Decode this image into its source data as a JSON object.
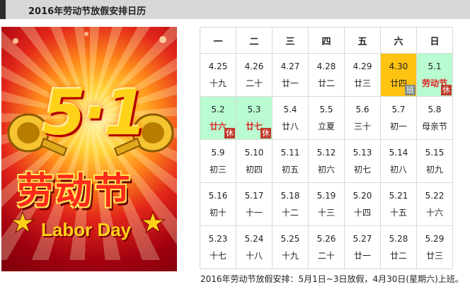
{
  "header": {
    "title": "2016年劳动节放假安排日历"
  },
  "poster": {
    "number": "5·1",
    "festival": "劳动节",
    "labor_day": "Labor Day"
  },
  "calendar": {
    "weekdays": [
      "一",
      "二",
      "三",
      "四",
      "五",
      "六",
      "日"
    ],
    "rows": [
      [
        {
          "date": "4.25",
          "lunar": "十九"
        },
        {
          "date": "4.26",
          "lunar": "二十"
        },
        {
          "date": "4.27",
          "lunar": "廿一"
        },
        {
          "date": "4.28",
          "lunar": "廿二"
        },
        {
          "date": "4.29",
          "lunar": "廿三"
        },
        {
          "date": "4.30",
          "lunar": "廿四",
          "type": "work",
          "tag": "班"
        },
        {
          "date": "5.1",
          "lunar": "劳动节",
          "type": "holiday",
          "tag": "休"
        }
      ],
      [
        {
          "date": "5.2",
          "lunar": "廿六",
          "type": "holiday",
          "tag": "休"
        },
        {
          "date": "5.3",
          "lunar": "廿七",
          "type": "holiday",
          "tag": "休"
        },
        {
          "date": "5.4",
          "lunar": "廿八"
        },
        {
          "date": "5.5",
          "lunar": "立夏"
        },
        {
          "date": "5.6",
          "lunar": "三十"
        },
        {
          "date": "5.7",
          "lunar": "初一"
        },
        {
          "date": "5.8",
          "lunar": "母亲节"
        }
      ],
      [
        {
          "date": "5.9",
          "lunar": "初三"
        },
        {
          "date": "5.10",
          "lunar": "初四"
        },
        {
          "date": "5.11",
          "lunar": "初五"
        },
        {
          "date": "5.12",
          "lunar": "初六"
        },
        {
          "date": "5.13",
          "lunar": "初七"
        },
        {
          "date": "5.14",
          "lunar": "初八"
        },
        {
          "date": "5.15",
          "lunar": "初九"
        }
      ],
      [
        {
          "date": "5.16",
          "lunar": "初十"
        },
        {
          "date": "5.17",
          "lunar": "十一"
        },
        {
          "date": "5.18",
          "lunar": "十二"
        },
        {
          "date": "5.19",
          "lunar": "十三"
        },
        {
          "date": "5.20",
          "lunar": "十四"
        },
        {
          "date": "5.21",
          "lunar": "十五"
        },
        {
          "date": "5.22",
          "lunar": "十六"
        }
      ],
      [
        {
          "date": "5.23",
          "lunar": "十七"
        },
        {
          "date": "5.24",
          "lunar": "十八"
        },
        {
          "date": "5.25",
          "lunar": "十九"
        },
        {
          "date": "5.26",
          "lunar": "二十"
        },
        {
          "date": "5.27",
          "lunar": "廿一"
        },
        {
          "date": "5.28",
          "lunar": "廿二"
        },
        {
          "date": "5.29",
          "lunar": "廿三"
        }
      ]
    ]
  },
  "note": "2016年劳动节放假安排：5月1日~3日放假，4月30日(星期六)上班。",
  "colors": {
    "holiday": "#b9fcd2",
    "work": "#ffc312",
    "rest_tag": "#c0392b",
    "shift_tag": "#7f8c8d",
    "holiday_text": "#e02020"
  }
}
